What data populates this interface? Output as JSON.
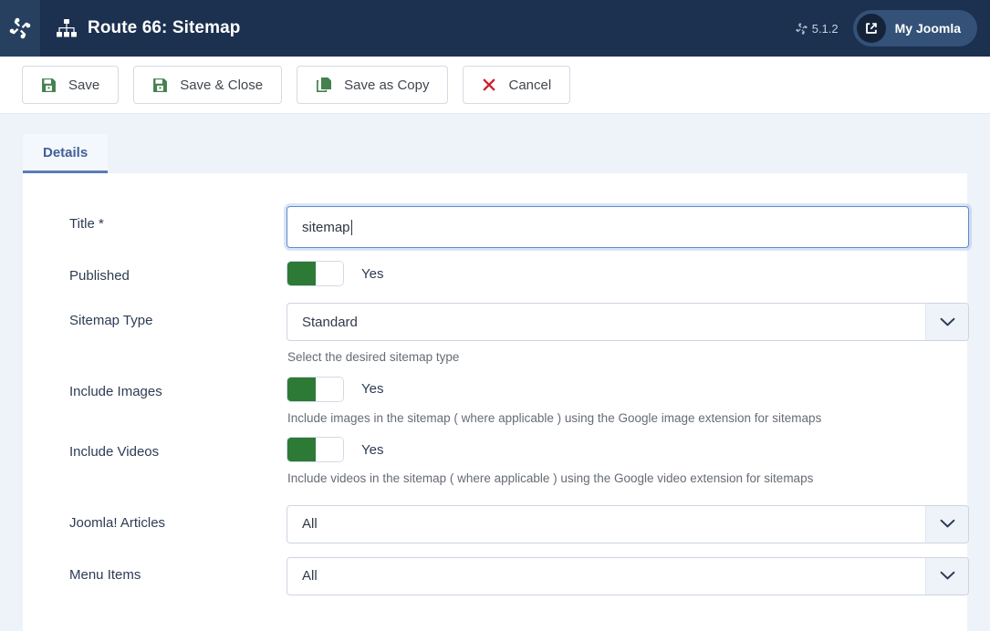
{
  "header": {
    "logo_icon": "joomla-logo-icon",
    "page_icon": "sitemap-icon",
    "title": "Route 66: Sitemap",
    "version": "5.1.2",
    "version_icon": "joomla-mini-icon",
    "my_joomla_label": "My Joomla",
    "my_joomla_icon": "external-link-icon"
  },
  "toolbar": {
    "buttons": [
      {
        "label": "Save",
        "icon": "save-floppy-icon"
      },
      {
        "label": "Save & Close",
        "icon": "save-floppy-icon"
      },
      {
        "label": "Save as Copy",
        "icon": "copy-icon"
      },
      {
        "label": "Cancel",
        "icon": "close-x-icon"
      }
    ]
  },
  "tabs": [
    {
      "label": "Details",
      "active": true
    }
  ],
  "form": {
    "title": {
      "label": "Title *",
      "value": "sitemap",
      "placeholder": ""
    },
    "published": {
      "label": "Published",
      "state": "Yes"
    },
    "sitemap_type": {
      "label": "Sitemap Type",
      "value": "Standard",
      "help": "Select the desired sitemap type",
      "arrow_icon": "chevron-down-icon"
    },
    "include_images": {
      "label": "Include Images",
      "state": "Yes",
      "help": "Include images in the sitemap ( where applicable ) using the Google image extension for sitemaps"
    },
    "include_videos": {
      "label": "Include Videos",
      "state": "Yes",
      "help": "Include videos in the sitemap ( where applicable ) using the Google video extension for sitemaps"
    },
    "joomla_articles": {
      "label": "Joomla! Articles",
      "value": "All",
      "arrow_icon": "chevron-down-icon"
    },
    "menu_items": {
      "label": "Menu Items",
      "value": "All",
      "arrow_icon": "chevron-down-icon"
    }
  },
  "colors": {
    "header_bg": "#1c3050",
    "brand_bg": "#27405f",
    "page_bg": "#eef2f9",
    "accent_green": "#2c7a36",
    "danger_red": "#cc2229",
    "tab_accent": "#5b7bb5",
    "focus_blue": "#5e8ccc"
  }
}
